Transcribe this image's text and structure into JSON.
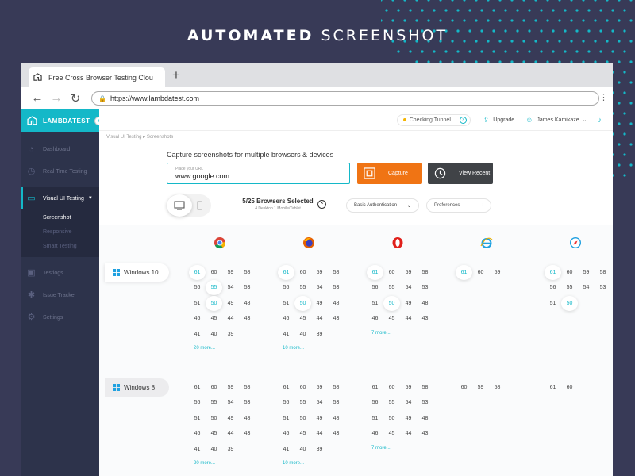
{
  "headline": {
    "bold": "AUTOMATED",
    "light": "SCREENSHOT"
  },
  "colors": {
    "background": "#383a57",
    "accent": "#14b8c8",
    "capture": "#f07414",
    "sidebar": "#2d334b",
    "dots": "#14b8c8"
  },
  "browser": {
    "tab_title": "Free Cross Browser Testing Clou",
    "new_tab": "+",
    "url": "https://www.lambdatest.com"
  },
  "sidebar": {
    "brand": "LAMBDATEST",
    "items_top": [
      {
        "label": "Dashboard",
        "icon": "gauge-icon"
      },
      {
        "label": "Real Time Testing",
        "icon": "clock-icon"
      }
    ],
    "active": {
      "label": "Visual UI Testing",
      "icon": "monitor-icon"
    },
    "sub_items": [
      "Screenshot",
      "Responsive",
      "Smart Testing"
    ],
    "items_bottom": [
      {
        "label": "Testlogs",
        "icon": "box-icon"
      },
      {
        "label": "Issue Tracker",
        "icon": "bug-icon"
      },
      {
        "label": "Settings",
        "icon": "gear-icon"
      }
    ]
  },
  "topbar": {
    "tunnel": "Checking Tunnel...",
    "upgrade": "Upgrade",
    "user": "James Kamikaze"
  },
  "breadcrumb": {
    "first": "Visual UI Testing",
    "sep": "▸",
    "second": "Screenshots"
  },
  "capture_form": {
    "heading": "Capture screenshots for multiple browsers & devices",
    "url_placeholder": "Place your URL",
    "url_value": "www.google.com",
    "capture_label": "Capture",
    "recent_label": "View Recent",
    "selected_title": "5/25 Browsers Selected",
    "selected_sub": "4 Desktop 1 Mobile/Tablet",
    "auth_label": "Basic Authentication",
    "pref_label": "Preferences"
  },
  "browsers": [
    "chrome-icon",
    "firefox-icon",
    "opera-icon",
    "ie-icon",
    "safari-icon"
  ],
  "os_rows": [
    {
      "name": "Windows 10",
      "columns": [
        {
          "versions": [
            "61",
            "60",
            "59",
            "58",
            "56",
            "55",
            "54",
            "53",
            "51",
            "50",
            "49",
            "48",
            "46",
            "45",
            "44",
            "43",
            "41",
            "40",
            "39"
          ],
          "selected": [
            "61",
            "55",
            "50"
          ],
          "more": "20 more..."
        },
        {
          "versions": [
            "61",
            "60",
            "59",
            "58",
            "56",
            "55",
            "54",
            "53",
            "51",
            "50",
            "49",
            "48",
            "46",
            "45",
            "44",
            "43",
            "41",
            "40",
            "39"
          ],
          "selected": [
            "61",
            "50"
          ],
          "more": "10 more..."
        },
        {
          "versions": [
            "61",
            "60",
            "59",
            "58",
            "56",
            "55",
            "54",
            "53",
            "51",
            "50",
            "49",
            "48",
            "46",
            "45",
            "44",
            "43"
          ],
          "selected": [
            "61",
            "50"
          ],
          "more": "7 more..."
        },
        {
          "versions": [
            "61",
            "60",
            "59"
          ],
          "selected": [
            "61"
          ],
          "more": ""
        },
        {
          "versions": [
            "61",
            "60",
            "59",
            "58",
            "56",
            "55",
            "54",
            "53",
            "51",
            "50"
          ],
          "selected": [
            "61",
            "50"
          ],
          "more": ""
        }
      ]
    },
    {
      "name": "Windows 8",
      "columns": [
        {
          "versions": [
            "61",
            "60",
            "59",
            "58",
            "56",
            "55",
            "54",
            "53",
            "51",
            "50",
            "49",
            "48",
            "46",
            "45",
            "44",
            "43",
            "41",
            "40",
            "39"
          ],
          "selected": [],
          "more": "20 more..."
        },
        {
          "versions": [
            "61",
            "60",
            "59",
            "58",
            "56",
            "55",
            "54",
            "53",
            "51",
            "50",
            "49",
            "48",
            "46",
            "45",
            "44",
            "43",
            "41",
            "40",
            "39"
          ],
          "selected": [],
          "more": "10 more..."
        },
        {
          "versions": [
            "61",
            "60",
            "59",
            "58",
            "56",
            "55",
            "54",
            "53",
            "51",
            "50",
            "49",
            "48",
            "46",
            "45",
            "44",
            "43"
          ],
          "selected": [],
          "more": "7 more..."
        },
        {
          "versions": [
            "60",
            "59",
            "58"
          ],
          "selected": [],
          "more": ""
        },
        {
          "versions": [
            "61",
            "60"
          ],
          "selected": [],
          "more": ""
        }
      ]
    }
  ]
}
